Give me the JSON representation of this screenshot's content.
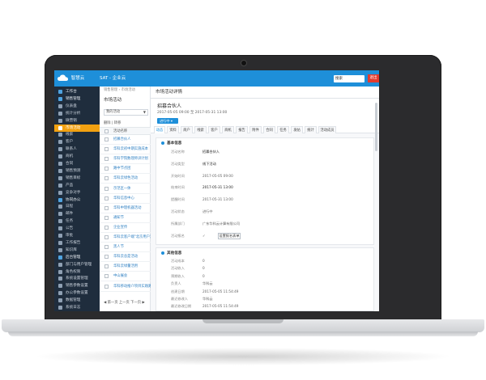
{
  "app": {
    "logo_text": "智慧云",
    "window_title": "SAT - 企业云",
    "alert_label": "退出",
    "search_value": "搜索",
    "brand_color": "#1e8fd9",
    "active_color": "#f2a111"
  },
  "sidebar": {
    "items": [
      {
        "label": "工作台",
        "icon": "home-icon",
        "type": "head"
      },
      {
        "label": "销售管理",
        "icon": "cart-icon",
        "type": "head"
      },
      {
        "label": "仪表盘",
        "icon": "dashboard-icon",
        "type": "item"
      },
      {
        "label": "统计分析",
        "icon": "chart-icon",
        "type": "item"
      },
      {
        "label": "微营销",
        "icon": "megaphone-icon",
        "type": "item"
      },
      {
        "label": "市场活动",
        "icon": "flag-icon",
        "type": "active"
      },
      {
        "label": "线索",
        "icon": "lead-icon",
        "type": "item"
      },
      {
        "label": "客户",
        "icon": "customer-icon",
        "type": "item"
      },
      {
        "label": "联系人",
        "icon": "contact-icon",
        "type": "item"
      },
      {
        "label": "商机",
        "icon": "opportunity-icon",
        "type": "item"
      },
      {
        "label": "合同",
        "icon": "contract-icon",
        "type": "item"
      },
      {
        "label": "销售预测",
        "icon": "forecast-icon",
        "type": "item"
      },
      {
        "label": "销售目标",
        "icon": "target-icon",
        "type": "item"
      },
      {
        "label": "产品",
        "icon": "product-icon",
        "type": "item"
      },
      {
        "label": "竞争对手",
        "icon": "competitor-icon",
        "type": "item"
      },
      {
        "label": "协同办公",
        "icon": "team-icon",
        "type": "head"
      },
      {
        "label": "日程",
        "icon": "calendar-icon",
        "type": "item"
      },
      {
        "label": "邮件",
        "icon": "mail-icon",
        "type": "item"
      },
      {
        "label": "任务",
        "icon": "task-icon",
        "type": "item"
      },
      {
        "label": "公告",
        "icon": "notice-icon",
        "type": "item"
      },
      {
        "label": "审批",
        "icon": "approve-icon",
        "type": "item"
      },
      {
        "label": "工作报告",
        "icon": "report-icon",
        "type": "item"
      },
      {
        "label": "知识库",
        "icon": "book-icon",
        "type": "item"
      },
      {
        "label": "后台管理",
        "icon": "settings-icon",
        "type": "head"
      },
      {
        "label": "部门与用户管理",
        "icon": "org-icon",
        "type": "item"
      },
      {
        "label": "角色权限",
        "icon": "role-icon",
        "type": "item"
      },
      {
        "label": "系统设置管理",
        "icon": "system-icon",
        "type": "item"
      },
      {
        "label": "销售参数设置",
        "icon": "param-icon",
        "type": "item"
      },
      {
        "label": "办公参数设置",
        "icon": "office-icon",
        "type": "item"
      },
      {
        "label": "数据管理",
        "icon": "database-icon",
        "type": "item"
      },
      {
        "label": "系统日志",
        "icon": "log-icon",
        "type": "item"
      }
    ]
  },
  "list": {
    "breadcrumb": "销售管理 › 市场活动",
    "title": "市场活动",
    "filter_value": "我的活动",
    "ops": "删除 | 转移",
    "column_header": "活动名称",
    "rows": [
      "招募合伙人",
      "华科云初中期实施成本",
      "华科学院数理师训计划",
      "路中节点团",
      "华科云绿色活动",
      "示范区一体",
      "华科信息中心",
      "华科中理机器活动",
      "通知节",
      "企业宣传",
      "华科云客户端\"北京用户活动\"",
      "黑人节",
      "华科云总是活动",
      "华科云绿量活用",
      "中山展会",
      "华科移动推介项目实践路演"
    ],
    "pager": "◀ 第一页  上一页  下一页 ▶"
  },
  "detail": {
    "panel_title": "市场活动详情",
    "name": "招募合伙人",
    "date_range": "2017-05-05 09:00 至 2017-05-31 13:00",
    "status": "进行中 ▾",
    "tabs": [
      "动态",
      "资料",
      "商户",
      "线索",
      "客户",
      "商机",
      "报告",
      "附件",
      "合同",
      "任务",
      "发帖",
      "统计",
      "活动成员"
    ],
    "basic_title": "基本信息",
    "basic_fields": [
      {
        "label": "活动名称",
        "value": "招募合伙人",
        "strong": true
      },
      {
        "label": "活动类型",
        "value": "线下活动",
        "strong": true
      },
      {
        "label": "开始时间",
        "value": "2017-05-05 09:00",
        "strong": false
      },
      {
        "label": "结束时间",
        "value": "2017-05-31 13:00",
        "strong": true
      },
      {
        "label": "提醒时间",
        "value": "2017-05-31 13:00",
        "strong": false
      },
      {
        "label": "活动状态",
        "value": "进行中",
        "strong": false
      },
      {
        "label": "所属部门",
        "value": "广东华科云计算有限公司",
        "strong": false
      },
      {
        "label": "活动报名",
        "value": "✓",
        "strong": false,
        "button": "设置报名表单"
      }
    ],
    "extra_title": "其他信息",
    "extra_fields": [
      {
        "label": "活动成本",
        "value": "0"
      },
      {
        "label": "活动收入",
        "value": "0"
      },
      {
        "label": "预期收入",
        "value": "0"
      },
      {
        "label": "负责人",
        "value": "华科云"
      },
      {
        "label": "创建日期",
        "value": "2017-05-05 11:54:49"
      },
      {
        "label": "最近修改人",
        "value": "华科云"
      },
      {
        "label": "最近修改日期",
        "value": "2017-05-05 11:54:49"
      }
    ]
  }
}
